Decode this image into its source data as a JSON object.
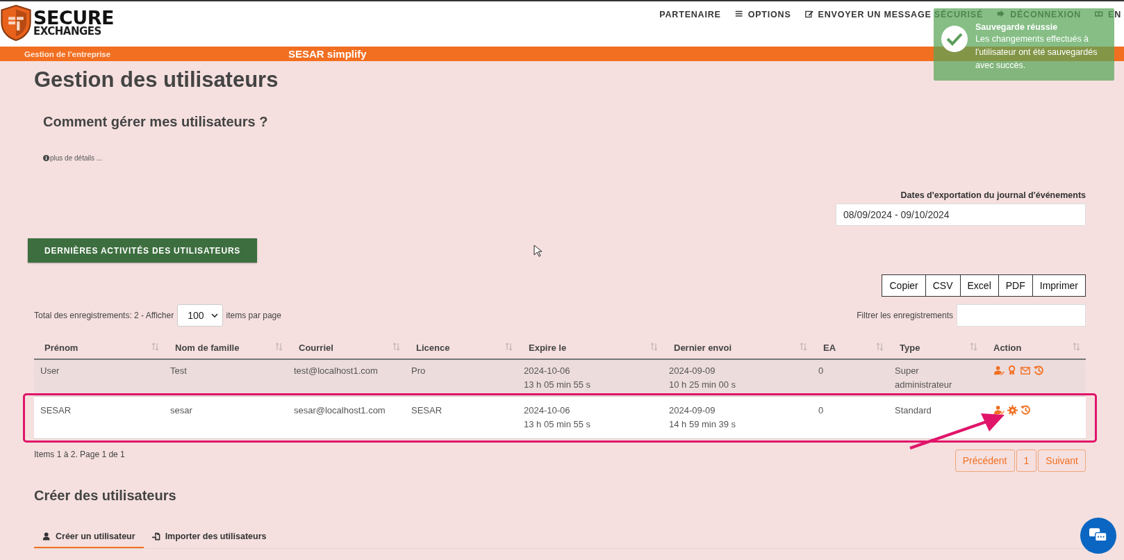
{
  "header": {
    "logo": {
      "line_1": "SECURE",
      "line_2": "EXCHANGES"
    },
    "nav": [
      {
        "label": "PARTENAIRE",
        "kind": "plain"
      },
      {
        "label": "OPTIONS",
        "kind": "menu"
      },
      {
        "label": "ENVOYER UN MESSAGE SÉCURISÉ",
        "kind": "compose"
      },
      {
        "label": "DÉCONNEXION",
        "kind": "logout"
      },
      {
        "label": "EN",
        "kind": "language"
      }
    ]
  },
  "subnav": {
    "section": "Gestion de l'entreprise",
    "product": "SESAR simplify"
  },
  "toast": {
    "title": "Sauvegarde réussie",
    "message": "Les changements effectués à l'utilisateur ont été sauvegardés avec succès."
  },
  "page_title": "Gestion des utilisateurs",
  "help": {
    "title": "Comment gérer mes utilisateurs ?",
    "link": "plus de détails ..."
  },
  "export": {
    "label": "Dates d'exportation du journal d'événements",
    "value": "08/09/2024 - 09/10/2024"
  },
  "activity_button": "DERNIÈRES ACTIVITÉS DES UTILISATEURS",
  "export_buttons": [
    "Copier",
    "CSV",
    "Excel",
    "PDF",
    "Imprimer"
  ],
  "page_size": {
    "before": "Total des enregistrements: 2 - Afficher",
    "value": "100",
    "after": "items par page"
  },
  "filter": {
    "label": "Filtrer les enregistrements"
  },
  "table": {
    "columns": [
      "Prénom",
      "Nom de famille",
      "Courriel",
      "Licence",
      "Expire le",
      "Dernier envoi",
      "EA",
      "Type",
      "Action"
    ],
    "rows": [
      {
        "cells": [
          "User",
          "Test",
          "test@localhost1.com",
          "Pro",
          "2024-10-06\n13 h 05 min 55 s",
          "2024-09-09\n10 h 25 min 00 s",
          "0",
          "Super administrateur"
        ],
        "actions": [
          {
            "kind": "edit-user"
          },
          {
            "kind": "award"
          },
          {
            "kind": "mail"
          },
          {
            "kind": "history"
          }
        ],
        "highlighted": false
      },
      {
        "cells": [
          "SESAR",
          "sesar",
          "sesar@localhost1.com",
          "SESAR",
          "2024-10-06\n13 h 05 min 55 s",
          "2024-09-09\n14 h 59 min 39 s",
          "0",
          "Standard"
        ],
        "actions": [
          {
            "kind": "edit-user"
          },
          {
            "kind": "settings"
          },
          {
            "kind": "history"
          }
        ],
        "highlighted": true
      }
    ]
  },
  "table_info": "Items 1 à 2. Page 1 de 1",
  "pagination": [
    "Précédent",
    "1",
    "Suivant"
  ],
  "create": {
    "title": "Créer des utilisateurs",
    "tabs": [
      {
        "label": "Créer un utilisateur",
        "kind": "user",
        "selected": true
      },
      {
        "label": "Importer des utilisateurs",
        "kind": "import",
        "selected": false
      }
    ]
  }
}
